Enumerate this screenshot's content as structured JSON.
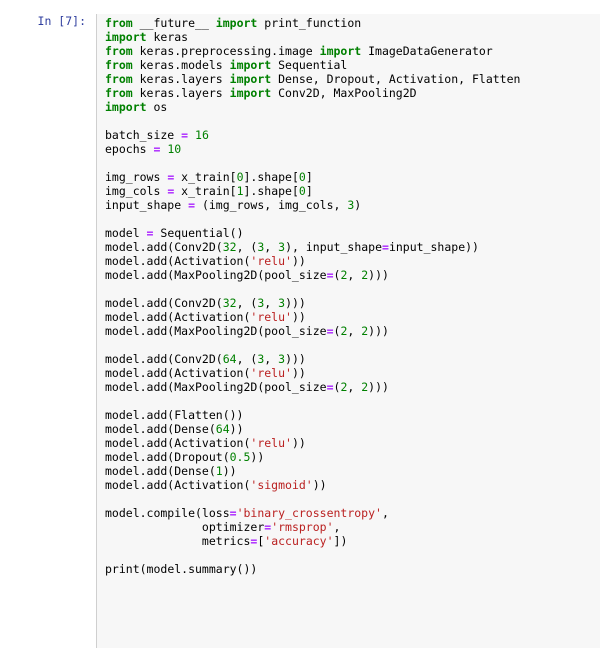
{
  "cell": {
    "prompt_label": "In [7]:",
    "execution_count": 7,
    "cell_type": "code",
    "language": "python"
  },
  "colors": {
    "page_background": "#ffffff",
    "cell_background": "#f7f7f7",
    "cell_border": "#cfcfcf",
    "prompt_text": "#303F9F",
    "keyword": "#008000",
    "number": "#008000",
    "string": "#BA2121",
    "operator": "#AA22FF",
    "plain_text": "#000000"
  },
  "source_lines": [
    "from __future__ import print_function",
    "import keras",
    "from keras.preprocessing.image import ImageDataGenerator",
    "from keras.models import Sequential",
    "from keras.layers import Dense, Dropout, Activation, Flatten",
    "from keras.layers import Conv2D, MaxPooling2D",
    "import os",
    "",
    "batch_size = 16",
    "epochs = 10",
    "",
    "img_rows = x_train[0].shape[0]",
    "img_cols = x_train[1].shape[0]",
    "input_shape = (img_rows, img_cols, 3)",
    "",
    "model = Sequential()",
    "model.add(Conv2D(32, (3, 3), input_shape=input_shape))",
    "model.add(Activation('relu'))",
    "model.add(MaxPooling2D(pool_size=(2, 2)))",
    "",
    "model.add(Conv2D(32, (3, 3)))",
    "model.add(Activation('relu'))",
    "model.add(MaxPooling2D(pool_size=(2, 2)))",
    "",
    "model.add(Conv2D(64, (3, 3)))",
    "model.add(Activation('relu'))",
    "model.add(MaxPooling2D(pool_size=(2, 2)))",
    "",
    "model.add(Flatten())",
    "model.add(Dense(64))",
    "model.add(Activation('relu'))",
    "model.add(Dropout(0.5))",
    "model.add(Dense(1))",
    "model.add(Activation('sigmoid'))",
    "",
    "model.compile(loss='binary_crossentropy',",
    "              optimizer='rmsprop',",
    "              metrics=['accuracy'])",
    "",
    "print(model.summary())"
  ],
  "highlighted_lines": [
    [
      {
        "t": "from",
        "c": "k"
      },
      {
        "t": " __future__ ",
        "c": "p"
      },
      {
        "t": "import",
        "c": "k"
      },
      {
        "t": " print_function",
        "c": "p"
      }
    ],
    [
      {
        "t": "import",
        "c": "k"
      },
      {
        "t": " keras",
        "c": "p"
      }
    ],
    [
      {
        "t": "from",
        "c": "k"
      },
      {
        "t": " keras.preprocessing.image ",
        "c": "p"
      },
      {
        "t": "import",
        "c": "k"
      },
      {
        "t": " ImageDataGenerator",
        "c": "p"
      }
    ],
    [
      {
        "t": "from",
        "c": "k"
      },
      {
        "t": " keras.models ",
        "c": "p"
      },
      {
        "t": "import",
        "c": "k"
      },
      {
        "t": " Sequential",
        "c": "p"
      }
    ],
    [
      {
        "t": "from",
        "c": "k"
      },
      {
        "t": " keras.layers ",
        "c": "p"
      },
      {
        "t": "import",
        "c": "k"
      },
      {
        "t": " Dense, Dropout, Activation, Flatten",
        "c": "p"
      }
    ],
    [
      {
        "t": "from",
        "c": "k"
      },
      {
        "t": " keras.layers ",
        "c": "p"
      },
      {
        "t": "import",
        "c": "k"
      },
      {
        "t": " Conv2D, MaxPooling2D",
        "c": "p"
      }
    ],
    [
      {
        "t": "import",
        "c": "k"
      },
      {
        "t": " os",
        "c": "p"
      }
    ],
    [],
    [
      {
        "t": "batch_size ",
        "c": "p"
      },
      {
        "t": "=",
        "c": "o"
      },
      {
        "t": " ",
        "c": "p"
      },
      {
        "t": "16",
        "c": "n"
      }
    ],
    [
      {
        "t": "epochs ",
        "c": "p"
      },
      {
        "t": "=",
        "c": "o"
      },
      {
        "t": " ",
        "c": "p"
      },
      {
        "t": "10",
        "c": "n"
      }
    ],
    [],
    [
      {
        "t": "img_rows ",
        "c": "p"
      },
      {
        "t": "=",
        "c": "o"
      },
      {
        "t": " x_train[",
        "c": "p"
      },
      {
        "t": "0",
        "c": "n"
      },
      {
        "t": "].shape[",
        "c": "p"
      },
      {
        "t": "0",
        "c": "n"
      },
      {
        "t": "]",
        "c": "p"
      }
    ],
    [
      {
        "t": "img_cols ",
        "c": "p"
      },
      {
        "t": "=",
        "c": "o"
      },
      {
        "t": " x_train[",
        "c": "p"
      },
      {
        "t": "1",
        "c": "n"
      },
      {
        "t": "].shape[",
        "c": "p"
      },
      {
        "t": "0",
        "c": "n"
      },
      {
        "t": "]",
        "c": "p"
      }
    ],
    [
      {
        "t": "input_shape ",
        "c": "p"
      },
      {
        "t": "=",
        "c": "o"
      },
      {
        "t": " (img_rows, img_cols, ",
        "c": "p"
      },
      {
        "t": "3",
        "c": "n"
      },
      {
        "t": ")",
        "c": "p"
      }
    ],
    [],
    [
      {
        "t": "model ",
        "c": "p"
      },
      {
        "t": "=",
        "c": "o"
      },
      {
        "t": " Sequential()",
        "c": "p"
      }
    ],
    [
      {
        "t": "model.add(Conv2D(",
        "c": "p"
      },
      {
        "t": "32",
        "c": "n"
      },
      {
        "t": ", (",
        "c": "p"
      },
      {
        "t": "3",
        "c": "n"
      },
      {
        "t": ", ",
        "c": "p"
      },
      {
        "t": "3",
        "c": "n"
      },
      {
        "t": "), input_shape",
        "c": "p"
      },
      {
        "t": "=",
        "c": "o"
      },
      {
        "t": "input_shape))",
        "c": "p"
      }
    ],
    [
      {
        "t": "model.add(Activation(",
        "c": "p"
      },
      {
        "t": "'relu'",
        "c": "s"
      },
      {
        "t": "))",
        "c": "p"
      }
    ],
    [
      {
        "t": "model.add(MaxPooling2D(pool_size",
        "c": "p"
      },
      {
        "t": "=",
        "c": "o"
      },
      {
        "t": "(",
        "c": "p"
      },
      {
        "t": "2",
        "c": "n"
      },
      {
        "t": ", ",
        "c": "p"
      },
      {
        "t": "2",
        "c": "n"
      },
      {
        "t": ")))",
        "c": "p"
      }
    ],
    [],
    [
      {
        "t": "model.add(Conv2D(",
        "c": "p"
      },
      {
        "t": "32",
        "c": "n"
      },
      {
        "t": ", (",
        "c": "p"
      },
      {
        "t": "3",
        "c": "n"
      },
      {
        "t": ", ",
        "c": "p"
      },
      {
        "t": "3",
        "c": "n"
      },
      {
        "t": ")))",
        "c": "p"
      }
    ],
    [
      {
        "t": "model.add(Activation(",
        "c": "p"
      },
      {
        "t": "'relu'",
        "c": "s"
      },
      {
        "t": "))",
        "c": "p"
      }
    ],
    [
      {
        "t": "model.add(MaxPooling2D(pool_size",
        "c": "p"
      },
      {
        "t": "=",
        "c": "o"
      },
      {
        "t": "(",
        "c": "p"
      },
      {
        "t": "2",
        "c": "n"
      },
      {
        "t": ", ",
        "c": "p"
      },
      {
        "t": "2",
        "c": "n"
      },
      {
        "t": ")))",
        "c": "p"
      }
    ],
    [],
    [
      {
        "t": "model.add(Conv2D(",
        "c": "p"
      },
      {
        "t": "64",
        "c": "n"
      },
      {
        "t": ", (",
        "c": "p"
      },
      {
        "t": "3",
        "c": "n"
      },
      {
        "t": ", ",
        "c": "p"
      },
      {
        "t": "3",
        "c": "n"
      },
      {
        "t": ")))",
        "c": "p"
      }
    ],
    [
      {
        "t": "model.add(Activation(",
        "c": "p"
      },
      {
        "t": "'relu'",
        "c": "s"
      },
      {
        "t": "))",
        "c": "p"
      }
    ],
    [
      {
        "t": "model.add(MaxPooling2D(pool_size",
        "c": "p"
      },
      {
        "t": "=",
        "c": "o"
      },
      {
        "t": "(",
        "c": "p"
      },
      {
        "t": "2",
        "c": "n"
      },
      {
        "t": ", ",
        "c": "p"
      },
      {
        "t": "2",
        "c": "n"
      },
      {
        "t": ")))",
        "c": "p"
      }
    ],
    [],
    [
      {
        "t": "model.add(Flatten())",
        "c": "p"
      }
    ],
    [
      {
        "t": "model.add(Dense(",
        "c": "p"
      },
      {
        "t": "64",
        "c": "n"
      },
      {
        "t": "))",
        "c": "p"
      }
    ],
    [
      {
        "t": "model.add(Activation(",
        "c": "p"
      },
      {
        "t": "'relu'",
        "c": "s"
      },
      {
        "t": "))",
        "c": "p"
      }
    ],
    [
      {
        "t": "model.add(Dropout(",
        "c": "p"
      },
      {
        "t": "0.5",
        "c": "n"
      },
      {
        "t": "))",
        "c": "p"
      }
    ],
    [
      {
        "t": "model.add(Dense(",
        "c": "p"
      },
      {
        "t": "1",
        "c": "n"
      },
      {
        "t": "))",
        "c": "p"
      }
    ],
    [
      {
        "t": "model.add(Activation(",
        "c": "p"
      },
      {
        "t": "'sigmoid'",
        "c": "s"
      },
      {
        "t": "))",
        "c": "p"
      }
    ],
    [],
    [
      {
        "t": "model.compile(loss",
        "c": "p"
      },
      {
        "t": "=",
        "c": "o"
      },
      {
        "t": "'binary_crossentropy'",
        "c": "s"
      },
      {
        "t": ",",
        "c": "p"
      }
    ],
    [
      {
        "t": "              optimizer",
        "c": "p"
      },
      {
        "t": "=",
        "c": "o"
      },
      {
        "t": "'rmsprop'",
        "c": "s"
      },
      {
        "t": ",",
        "c": "p"
      }
    ],
    [
      {
        "t": "              metrics",
        "c": "p"
      },
      {
        "t": "=",
        "c": "o"
      },
      {
        "t": "[",
        "c": "p"
      },
      {
        "t": "'accuracy'",
        "c": "s"
      },
      {
        "t": "])",
        "c": "p"
      }
    ],
    [],
    [
      {
        "t": "print",
        "c": "p"
      },
      {
        "t": "(model.summary())",
        "c": "p"
      }
    ]
  ]
}
